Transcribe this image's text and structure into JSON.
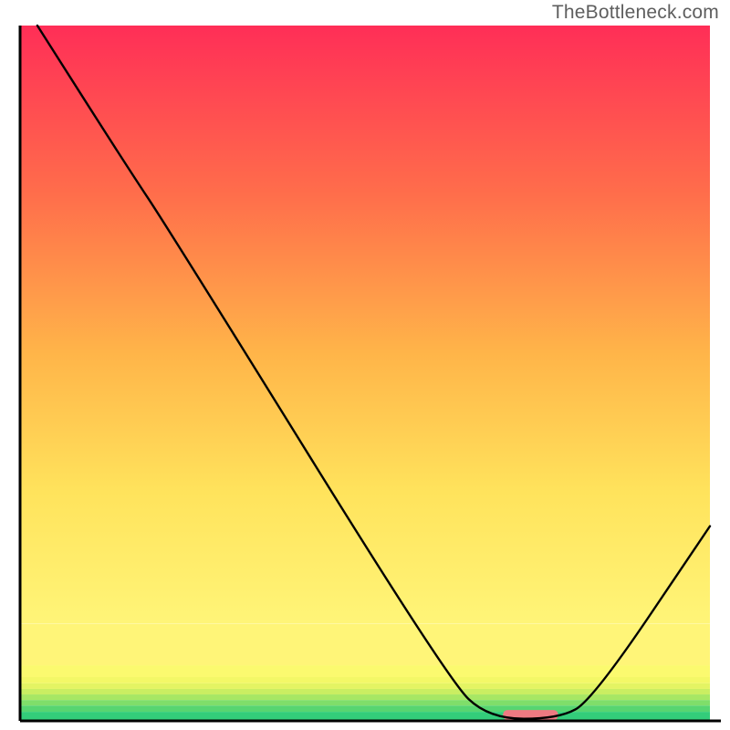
{
  "watermark": "TheBottleneck.com",
  "chart_data": {
    "type": "line",
    "title": "",
    "xlabel": "",
    "ylabel": "",
    "xlim": [
      0,
      100
    ],
    "ylim": [
      0,
      100
    ],
    "series": [
      {
        "name": "curve",
        "points": [
          {
            "x": 2.5,
            "y": 100
          },
          {
            "x": 15,
            "y": 80.5
          },
          {
            "x": 22,
            "y": 70
          },
          {
            "x": 62,
            "y": 6
          },
          {
            "x": 68,
            "y": 0.3
          },
          {
            "x": 78,
            "y": 0.3
          },
          {
            "x": 83,
            "y": 3
          },
          {
            "x": 100,
            "y": 28
          }
        ]
      }
    ],
    "marker": {
      "x_center": 74,
      "width_pct": 8,
      "color": "#ee7a82"
    },
    "bands": [
      {
        "y0": 0.0,
        "y1": 1.3,
        "color": "#33cd7a"
      },
      {
        "y0": 1.3,
        "y1": 2.2,
        "color": "#57d571"
      },
      {
        "y0": 2.2,
        "y1": 3.0,
        "color": "#7fde6a"
      },
      {
        "y0": 3.0,
        "y1": 3.8,
        "color": "#a7e764"
      },
      {
        "y0": 3.8,
        "y1": 4.6,
        "color": "#caee62"
      },
      {
        "y0": 4.6,
        "y1": 5.4,
        "color": "#e4f463"
      },
      {
        "y0": 5.4,
        "y1": 6.3,
        "color": "#f3f867"
      },
      {
        "y0": 6.3,
        "y1": 8.0,
        "color": "#fbfa6f"
      },
      {
        "y0": 8.0,
        "y1": 14.0,
        "color": "#fff578"
      }
    ],
    "gradient_top": "#ff2e57",
    "gradient_upper": "#ff6d4b",
    "gradient_mid": "#ffb549",
    "gradient_lower": "#ffe35c",
    "gradient_bottom": "#fff578"
  }
}
